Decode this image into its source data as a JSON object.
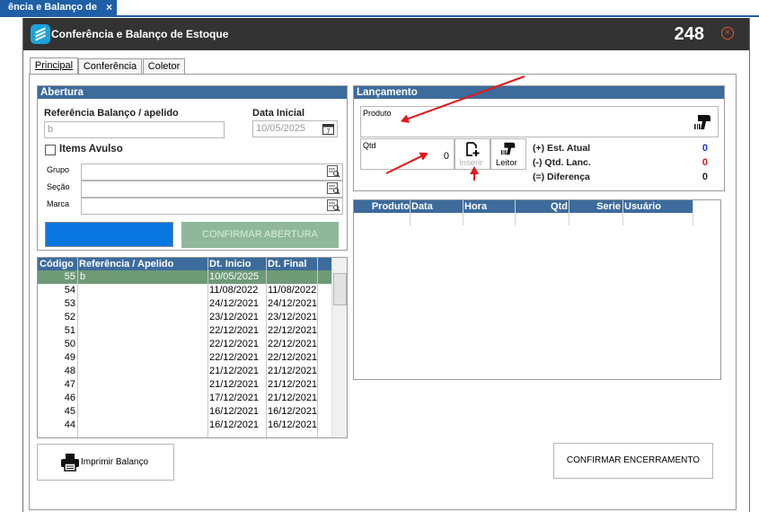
{
  "doc_tab": {
    "label": "ência e Balanço de",
    "close": "×"
  },
  "window": {
    "title": "Conferência e Balanço de Estoque",
    "number": "248"
  },
  "tabs": [
    {
      "label": "Principal",
      "active": true
    },
    {
      "label": "Conferência",
      "active": false
    },
    {
      "label": "Coletor",
      "active": false
    }
  ],
  "abertura": {
    "header": "Abertura",
    "ref_label": "Referência Balanço / apelido",
    "ref_value": "b",
    "date_label": "Data Inicial",
    "date_value": "10/05/2025",
    "itens_avulso": "Items Avulso",
    "grupo": "Grupo",
    "secao": "Seção",
    "marca": "Marca",
    "confirm_button": "CONFIRMAR ABERTURA"
  },
  "balance_table": {
    "columns": [
      "Código",
      "Referência / Apelido",
      "Dt. Inicio",
      "Dt. Final"
    ],
    "rows": [
      {
        "codigo": "55",
        "ref": "b",
        "inicio": "10/05/2025",
        "final": ""
      },
      {
        "codigo": "54",
        "ref": "",
        "inicio": "11/08/2022",
        "final": "11/08/2022"
      },
      {
        "codigo": "53",
        "ref": "",
        "inicio": "24/12/2021",
        "final": "24/12/2021"
      },
      {
        "codigo": "52",
        "ref": "",
        "inicio": "23/12/2021",
        "final": "23/12/2021"
      },
      {
        "codigo": "51",
        "ref": "",
        "inicio": "22/12/2021",
        "final": "22/12/2021"
      },
      {
        "codigo": "50",
        "ref": "",
        "inicio": "22/12/2021",
        "final": "22/12/2021"
      },
      {
        "codigo": "49",
        "ref": "",
        "inicio": "22/12/2021",
        "final": "22/12/2021"
      },
      {
        "codigo": "48",
        "ref": "",
        "inicio": "21/12/2021",
        "final": "21/12/2021"
      },
      {
        "codigo": "47",
        "ref": "",
        "inicio": "21/12/2021",
        "final": "21/12/2021"
      },
      {
        "codigo": "46",
        "ref": "",
        "inicio": "17/12/2021",
        "final": "21/12/2021"
      },
      {
        "codigo": "45",
        "ref": "",
        "inicio": "16/12/2021",
        "final": "16/12/2021"
      },
      {
        "codigo": "44",
        "ref": "",
        "inicio": "16/12/2021",
        "final": "16/12/2021"
      }
    ]
  },
  "lancamento": {
    "header": "Lançamento",
    "produto_label": "Produto",
    "qtd_label": "Qtd",
    "qtd_value": "0",
    "inserir": "Inserir",
    "leitor": "Leitor",
    "est_atual_label": "(+) Est. Atual",
    "est_atual_value": "0",
    "qtd_lanc_label": "(-) Qtd. Lanc.",
    "qtd_lanc_value": "0",
    "diferenca_label": "(=) Diferença",
    "diferenca_value": "0",
    "colors": {
      "est_atual": "#1a3ad6",
      "qtd_lanc": "#d61a1a",
      "diferenca": "#000000"
    }
  },
  "lanc_table": {
    "columns": [
      "Produto",
      "Data",
      "Hora",
      "Qtd",
      "Serie",
      "Usuário"
    ]
  },
  "footer": {
    "print_button": "Imprimir Balanço",
    "confirm_close_button": "CONFIRMAR ENCERRAMENTO"
  }
}
